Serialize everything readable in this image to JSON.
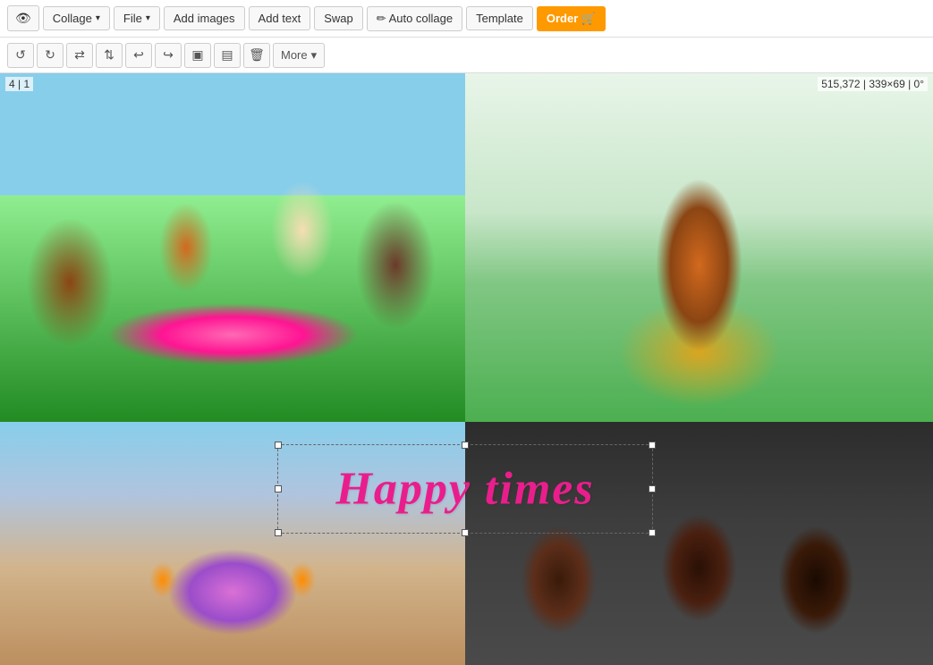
{
  "toolbar": {
    "eye_label": "👁",
    "collage_label": "Collage",
    "file_label": "File",
    "add_images_label": "Add images",
    "add_text_label": "Add text",
    "swap_label": "Swap",
    "auto_collage_label": "✏ Auto collage",
    "template_label": "Template",
    "order_label": "Order 🛒"
  },
  "second_toolbar": {
    "more_label": "More",
    "more_dropdown": "▾"
  },
  "canvas": {
    "status_left": "4 | 1",
    "status_right": "515,372 | 339×69 | 0°"
  },
  "text_overlay": {
    "content": "Happy times"
  }
}
